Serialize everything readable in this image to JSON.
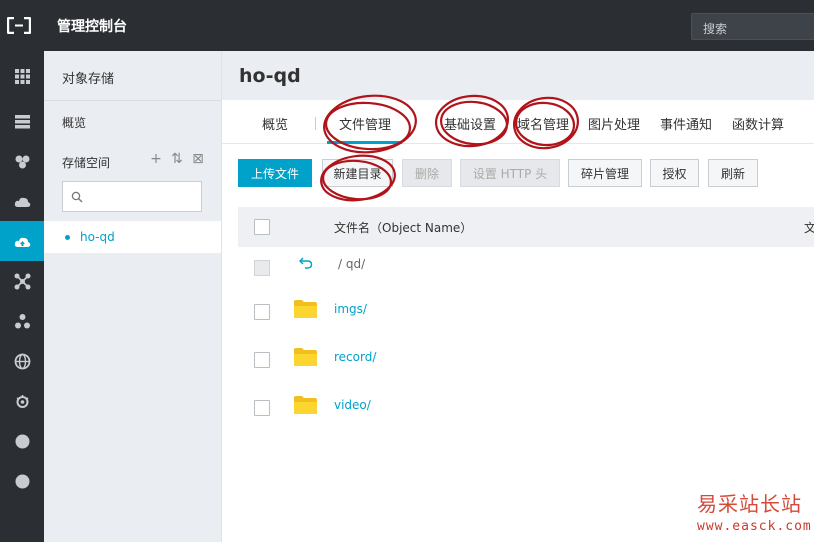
{
  "topbar": {
    "title": "管理控制台",
    "search_placeholder": "搜索"
  },
  "rail": {
    "icons": [
      "grid-icon",
      "server-icon",
      "network-icon",
      "cloud-icon",
      "cloud-upload-icon",
      "nodes-icon",
      "cluster-icon",
      "globe-icon",
      "gear-cloud-icon",
      "dot-icon",
      "dot-icon"
    ],
    "active_index": 4,
    "accent": "#00a2ca"
  },
  "sidebar": {
    "title": "对象存储",
    "overview": "概览",
    "space_label": "存储空间",
    "tools": [
      "+",
      "⇅",
      "⊠"
    ],
    "bucket": "ho-qd"
  },
  "main": {
    "title": "ho-qd",
    "tabs": [
      {
        "label": "概览"
      },
      {
        "label": "文件管理",
        "active": true
      },
      {
        "label": "基础设置"
      },
      {
        "label": "域名管理"
      },
      {
        "label": "图片处理"
      },
      {
        "label": "事件通知"
      },
      {
        "label": "函数计算"
      }
    ],
    "buttons": [
      {
        "label": "上传文件",
        "state": "primary"
      },
      {
        "label": "新建目录",
        "state": "normal"
      },
      {
        "label": "删除",
        "state": "disabled"
      },
      {
        "label": "设置 HTTP 头",
        "state": "disabled"
      },
      {
        "label": "碎片管理",
        "state": "normal"
      },
      {
        "label": "授权",
        "state": "normal"
      },
      {
        "label": "刷新",
        "state": "normal"
      }
    ],
    "table": {
      "header_name": "文件名（Object Name）",
      "header_more": "文",
      "path_row": {
        "text": "/  qd/"
      },
      "rows": [
        {
          "name": "imgs/"
        },
        {
          "name": "record/"
        },
        {
          "name": "video/"
        }
      ]
    }
  },
  "watermark": {
    "cn": "易采站长站",
    "url": "www.easck.com"
  }
}
